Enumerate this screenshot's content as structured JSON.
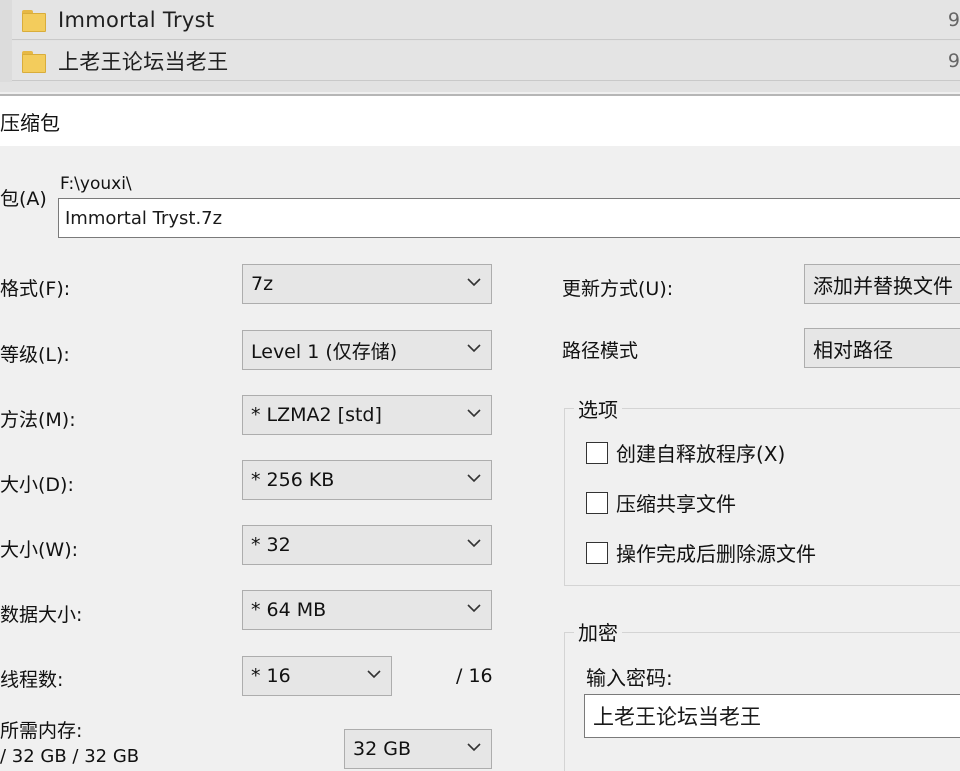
{
  "file_list": {
    "rows": [
      {
        "name": "Immortal Tryst",
        "size": "9"
      },
      {
        "name": "上老王论坛当老王",
        "size": "9"
      }
    ]
  },
  "dialog": {
    "title": "压缩包",
    "archive_label": "包(A)",
    "archive_path": "F:\\youxi\\",
    "archive_name": "Immortal Tryst.7z",
    "format_label": "格式(F):",
    "format_value": "7z",
    "level_label": "等级(L):",
    "level_value": "Level 1 (仅存储)",
    "method_label": "方法(M):",
    "method_value": "* LZMA2 [std]",
    "dict_label": "大小(D):",
    "dict_value": "* 256 KB",
    "word_label": "大小(W):",
    "word_value": "* 32",
    "solid_label": "数据大小:",
    "solid_value": "* 64 MB",
    "threads_label": "线程数:",
    "threads_value": "* 16",
    "threads_max": "/ 16",
    "memory_label": "所需内存:",
    "memory_values": "/ 32 GB / 32 GB",
    "memory_limit": "32 GB",
    "update_label": "更新方式(U):",
    "update_value": "添加并替换文件",
    "pathmode_label": "路径模式",
    "pathmode_value": "相对路径",
    "options": {
      "title": "选项",
      "items": [
        "创建自释放程序(X)",
        "压缩共享文件",
        "操作完成后删除源文件"
      ]
    },
    "encryption": {
      "title": "加密",
      "password_label": "输入密码:",
      "password_value": "上老王论坛当老王"
    }
  }
}
